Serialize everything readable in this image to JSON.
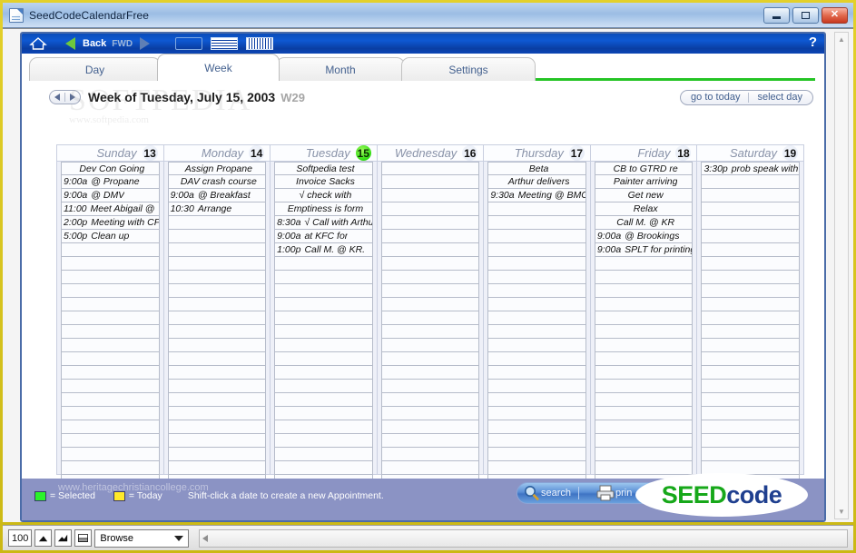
{
  "window": {
    "title": "SeedCodeCalendarFree",
    "icon": "document-icon",
    "buttons": {
      "minimize": "minimize-icon",
      "maximize": "maximize-icon",
      "close": "✕"
    }
  },
  "navbar": {
    "home_icon": "home-icon",
    "back_label": "Back",
    "forward_label": "FWD",
    "views": [
      "form-view-icon",
      "list-view-icon",
      "table-view-icon"
    ],
    "help_label": "?"
  },
  "tabs": [
    {
      "label": "Day",
      "active": false
    },
    {
      "label": "Week",
      "active": true
    },
    {
      "label": "Month",
      "active": false
    },
    {
      "label": "Settings",
      "active": false
    }
  ],
  "watermark": {
    "line1": "SOFTPEDIA",
    "line2": "www.softpedia.com"
  },
  "date_header": {
    "title": "Week of Tuesday, July 15, 2003",
    "week_number": "W29",
    "go_to_today": "go to today",
    "select_day": "select day"
  },
  "calendar": {
    "rows_per_day": 24,
    "days": [
      {
        "name": "Sunday",
        "number": "13",
        "selected": false,
        "events": [
          {
            "time": "",
            "text": "Dev Con Going",
            "centered": true
          },
          {
            "time": "9:00a",
            "text": "@ Propane"
          },
          {
            "time": "9:00a",
            "text": "@ DMV"
          },
          {
            "time": "11:00",
            "text": "Meet Abigail @"
          },
          {
            "time": "2:00p",
            "text": "Meeting with CFO"
          },
          {
            "time": "5:00p",
            "text": "Clean up"
          }
        ]
      },
      {
        "name": "Monday",
        "number": "14",
        "selected": false,
        "events": [
          {
            "time": "",
            "text": "Assign Propane",
            "centered": true
          },
          {
            "time": "",
            "text": "DAV crash course",
            "centered": true
          },
          {
            "time": "9:00a",
            "text": "@ Breakfast"
          },
          {
            "time": "10:30",
            "text": "Arrange"
          }
        ]
      },
      {
        "name": "Tuesday",
        "number": "15",
        "selected": true,
        "events": [
          {
            "time": "",
            "text": "Softpedia test",
            "centered": true
          },
          {
            "time": "",
            "text": "Invoice Sacks",
            "centered": true
          },
          {
            "time": "",
            "text": "√ check with",
            "centered": true
          },
          {
            "time": "",
            "text": "Emptiness is form",
            "centered": true
          },
          {
            "time": "8:30a",
            "text": "√ Call with Arthur"
          },
          {
            "time": "9:00a",
            "text": "at KFC for"
          },
          {
            "time": "1:00p",
            "text": "Call M. @ KR."
          }
        ]
      },
      {
        "name": "Wednesday",
        "number": "16",
        "selected": false,
        "events": []
      },
      {
        "name": "Thursday",
        "number": "17",
        "selected": false,
        "events": [
          {
            "time": "",
            "text": "Beta",
            "centered": true
          },
          {
            "time": "",
            "text": "Arthur delivers",
            "centered": true
          },
          {
            "time": "9:30a",
            "text": "Meeting @ BMC"
          }
        ]
      },
      {
        "name": "Friday",
        "number": "18",
        "selected": false,
        "events": [
          {
            "time": "",
            "text": "CB to GTRD re",
            "centered": true
          },
          {
            "time": "",
            "text": "Painter arriving",
            "centered": true
          },
          {
            "time": "",
            "text": "Get new",
            "centered": true
          },
          {
            "time": "",
            "text": "Relax",
            "centered": true
          },
          {
            "time": "",
            "text": "Call M. @ KR",
            "centered": true
          },
          {
            "time": "9:00a",
            "text": "@ Brookings"
          },
          {
            "time": "9:00a",
            "text": "SPLT for printing"
          }
        ]
      },
      {
        "name": "Saturday",
        "number": "19",
        "selected": false,
        "events": [
          {
            "time": "3:30p",
            "text": "prob speak with"
          }
        ]
      }
    ]
  },
  "footer": {
    "url": "www.heritagechristiancollege.com",
    "legend_selected": "= Selected",
    "legend_today": "= Today",
    "hint": "Shift-click a date to create a new Appointment.",
    "search_label": "search",
    "print_label": "prin",
    "logo_seed": "SEED",
    "logo_code": "code"
  },
  "statusbar": {
    "zoom": "100",
    "mode": "Browse"
  },
  "colors": {
    "selected_day": "#2bf32b",
    "today": "#ffe92b",
    "green_rule": "#25c425",
    "navbar_blue": "#0b4dbb",
    "logo_green": "#17a81a",
    "logo_blue": "#1f3f8f",
    "frame_yellow": "#d4c017",
    "footer_band": "#8b93c4"
  }
}
